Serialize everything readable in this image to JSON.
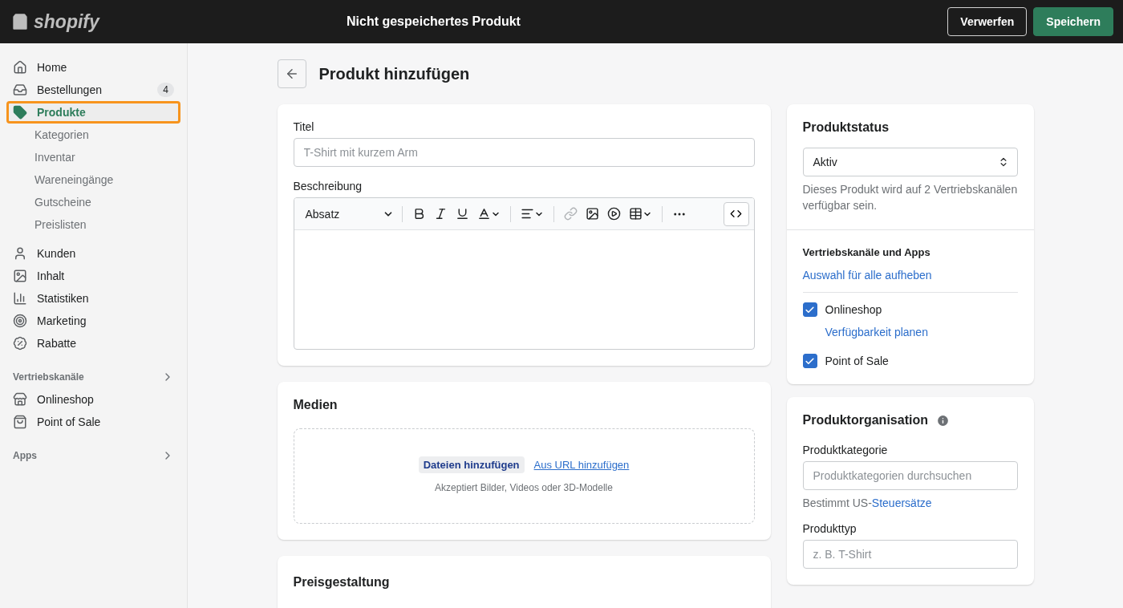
{
  "topbar": {
    "logo": "shopify",
    "title": "Nicht gespeichertes Produkt",
    "discard": "Verwerfen",
    "save": "Speichern"
  },
  "nav": {
    "items": [
      {
        "label": "Home",
        "selected": false,
        "highlighted": false
      },
      {
        "label": "Bestellungen",
        "selected": false,
        "highlighted": false,
        "badge": "4"
      },
      {
        "label": "Produkte",
        "selected": true,
        "highlighted": true,
        "children": [
          {
            "label": "Kategorien"
          },
          {
            "label": "Inventar"
          },
          {
            "label": "Wareneingänge"
          },
          {
            "label": "Gutscheine"
          },
          {
            "label": "Preislisten"
          }
        ]
      },
      {
        "label": "Kunden",
        "selected": false,
        "highlighted": false
      },
      {
        "label": "Inhalt",
        "selected": false,
        "highlighted": false
      },
      {
        "label": "Statistiken",
        "selected": false,
        "highlighted": false
      },
      {
        "label": "Marketing",
        "selected": false,
        "highlighted": false
      },
      {
        "label": "Rabatte",
        "selected": false,
        "highlighted": false
      }
    ],
    "sections": [
      {
        "title": "Vertriebskanäle",
        "items": [
          {
            "label": "Onlineshop"
          },
          {
            "label": "Point of Sale"
          }
        ]
      },
      {
        "title": "Apps"
      }
    ]
  },
  "page": {
    "title": "Produkt hinzufügen"
  },
  "general": {
    "title_label": "Titel",
    "title_placeholder": "T-Shirt mit kurzem Arm",
    "description_label": "Beschreibung",
    "format": "Absatz"
  },
  "media": {
    "heading": "Medien",
    "add_files": "Dateien hinzufügen",
    "add_url": "Aus URL hinzufügen",
    "hint": "Akzeptiert Bilder, Videos oder 3D-Modelle"
  },
  "pricing": {
    "heading": "Preisgestaltung"
  },
  "status": {
    "heading": "Produktstatus",
    "value": "Aktiv",
    "hint": "Dieses Produkt wird auf 2 Vertriebskanälen verfügbar sein.",
    "channels_heading": "Vertriebskanäle und Apps",
    "deselect": "Auswahl für alle aufheben",
    "channels": [
      {
        "label": "Onlineshop",
        "checked": true,
        "link": "Verfügbarkeit planen"
      },
      {
        "label": "Point of Sale",
        "checked": true
      }
    ]
  },
  "organization": {
    "heading": "Produktorganisation",
    "category_label": "Produktkategorie",
    "category_placeholder": "Produktkategorien durchsuchen",
    "tax_prefix": "Bestimmt US-",
    "tax_link": "Steuersätze",
    "type_label": "Produkttyp",
    "type_placeholder": "z. B. T-Shirt"
  }
}
